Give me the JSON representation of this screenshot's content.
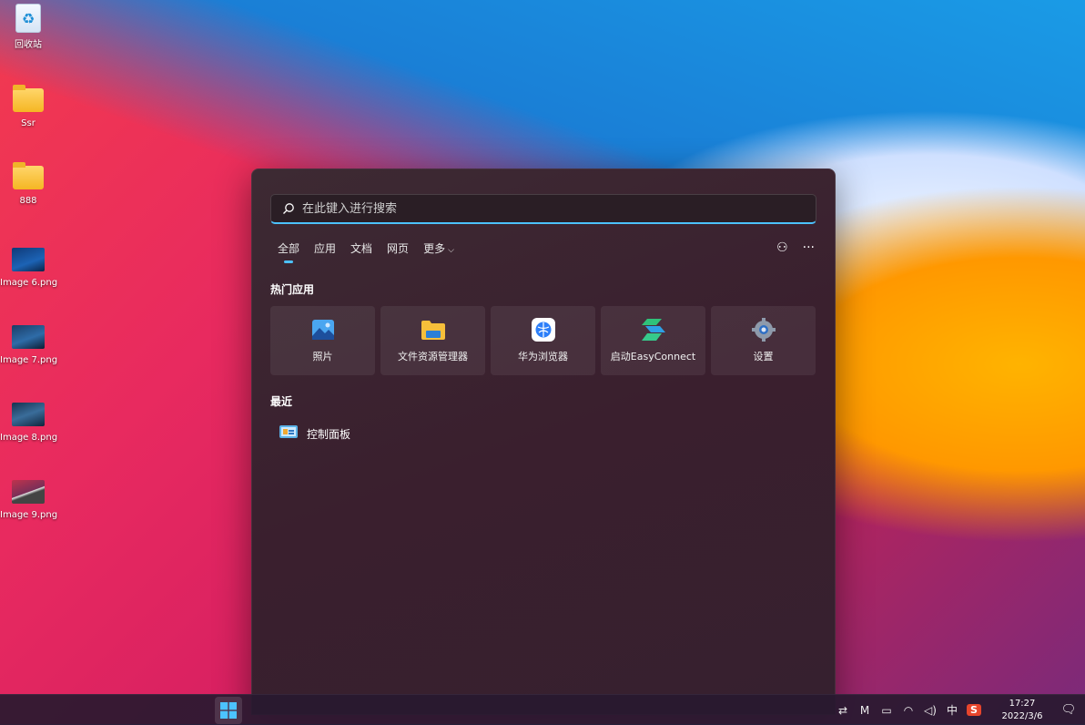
{
  "desktop": {
    "icons": [
      {
        "label": "回收站",
        "icon": "recycle-bin-icon"
      },
      {
        "label": "Ssr",
        "icon": "folder-icon"
      },
      {
        "label": "888",
        "icon": "folder-icon"
      },
      {
        "label": "Image 6.png",
        "icon": "image-thumbnail"
      },
      {
        "label": "Image 7.png",
        "icon": "image-thumbnail"
      },
      {
        "label": "Image 8.png",
        "icon": "image-thumbnail"
      },
      {
        "label": "Image 9.png",
        "icon": "image-thumbnail"
      }
    ]
  },
  "start_menu": {
    "search": {
      "placeholder": "在此键入进行搜索",
      "value": ""
    },
    "tabs": [
      {
        "label": "全部",
        "active": true
      },
      {
        "label": "应用"
      },
      {
        "label": "文档"
      },
      {
        "label": "网页"
      },
      {
        "label": "更多"
      }
    ],
    "top_apps_title": "热门应用",
    "top_apps": [
      {
        "label": "照片",
        "icon": "photos-icon"
      },
      {
        "label": "文件资源管理器",
        "icon": "file-explorer-icon"
      },
      {
        "label": "华为浏览器",
        "icon": "huawei-browser-icon"
      },
      {
        "label": "启动EasyConnect",
        "icon": "easyconnect-icon"
      },
      {
        "label": "设置",
        "icon": "settings-gear-icon"
      }
    ],
    "recent_title": "最近",
    "recent": [
      {
        "label": "控制面板",
        "icon": "control-panel-icon"
      }
    ]
  },
  "taskbar": {
    "ime_label": "中",
    "clock": {
      "time": "17:27",
      "date": "2022/3/6"
    }
  },
  "colors": {
    "accent": "#4cc2ff"
  }
}
